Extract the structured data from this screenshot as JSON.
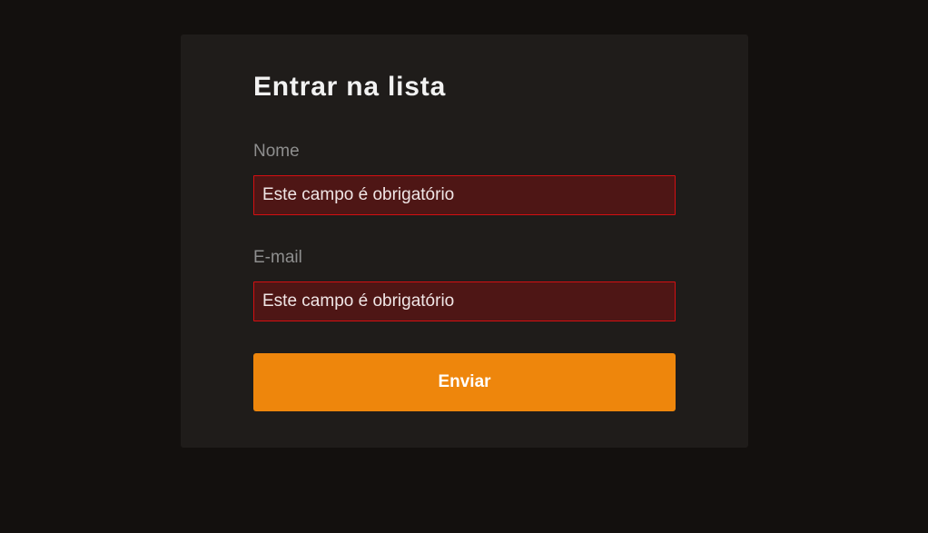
{
  "form": {
    "title": "Entrar na lista",
    "name_label": "Nome",
    "name_placeholder": "Este campo é obrigatório",
    "email_label": "E-mail",
    "email_placeholder": "Este campo é obrigatório",
    "submit_label": "Enviar"
  },
  "colors": {
    "page_background": "#13100e",
    "card_background": "#1f1c1a",
    "error_field_background": "#4e1615",
    "error_border": "#d40f12",
    "accent": "#ee860c"
  }
}
